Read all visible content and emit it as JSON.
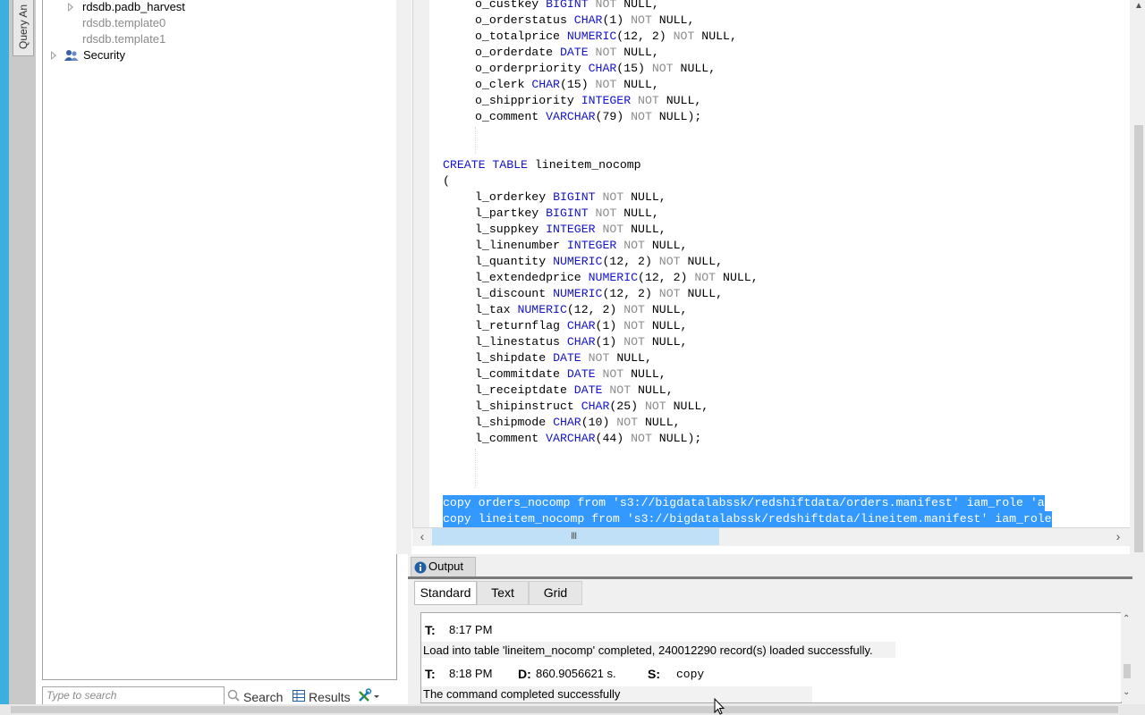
{
  "left_strip": {
    "vertical_tab_label": "Query An"
  },
  "tree": {
    "nodes": [
      {
        "label": "rdsdb.padb_harvest",
        "expandable": true,
        "muted": false
      },
      {
        "label": "rdsdb.template0",
        "expandable": false,
        "muted": true
      },
      {
        "label": "rdsdb.template1",
        "expandable": false,
        "muted": true
      },
      {
        "label": "Security",
        "expandable": true,
        "muted": false,
        "icon": "users-icon"
      }
    ]
  },
  "bottom_left": {
    "search_placeholder": "Type to search",
    "search_button": "Search",
    "results_button": "Results",
    "tools_icon": "tools-icon"
  },
  "editor": {
    "orders_cols": [
      {
        "name": "o_custkey",
        "type": "BIGINT",
        "args": "",
        "suffix": ","
      },
      {
        "name": "o_orderstatus",
        "type": "CHAR",
        "args": "(1)",
        "suffix": ","
      },
      {
        "name": "o_totalprice",
        "type": "NUMERIC",
        "args": "(12, 2)",
        "suffix": ","
      },
      {
        "name": "o_orderdate",
        "type": "DATE",
        "args": "",
        "suffix": ","
      },
      {
        "name": "o_orderpriority",
        "type": "CHAR",
        "args": "(15)",
        "suffix": ","
      },
      {
        "name": "o_clerk",
        "type": "CHAR",
        "args": "(15)",
        "suffix": ","
      },
      {
        "name": "o_shippriority",
        "type": "INTEGER",
        "args": "",
        "suffix": ","
      },
      {
        "name": "o_comment",
        "type": "VARCHAR",
        "args": "(79)",
        "suffix": ");"
      }
    ],
    "create_kw": "CREATE TABLE",
    "table_name": "lineitem_nocomp",
    "open_paren": "(",
    "lineitem_cols": [
      {
        "name": "l_orderkey",
        "type": "BIGINT",
        "args": "",
        "suffix": ","
      },
      {
        "name": "l_partkey",
        "type": "BIGINT",
        "args": "",
        "suffix": ","
      },
      {
        "name": "l_suppkey",
        "type": "INTEGER",
        "args": "",
        "suffix": ","
      },
      {
        "name": "l_linenumber",
        "type": "INTEGER",
        "args": "",
        "suffix": ","
      },
      {
        "name": "l_quantity",
        "type": "NUMERIC",
        "args": "(12, 2)",
        "suffix": ","
      },
      {
        "name": "l_extendedprice",
        "type": "NUMERIC",
        "args": "(12, 2)",
        "suffix": ","
      },
      {
        "name": "l_discount",
        "type": "NUMERIC",
        "args": "(12, 2)",
        "suffix": ","
      },
      {
        "name": "l_tax",
        "type": "NUMERIC",
        "args": "(12, 2)",
        "suffix": ","
      },
      {
        "name": "l_returnflag",
        "type": "CHAR",
        "args": "(1)",
        "suffix": ","
      },
      {
        "name": "l_linestatus",
        "type": "CHAR",
        "args": "(1)",
        "suffix": ","
      },
      {
        "name": "l_shipdate",
        "type": "DATE",
        "args": "",
        "suffix": ","
      },
      {
        "name": "l_commitdate",
        "type": "DATE",
        "args": "",
        "suffix": ","
      },
      {
        "name": "l_receiptdate",
        "type": "DATE",
        "args": "",
        "suffix": ","
      },
      {
        "name": "l_shipinstruct",
        "type": "CHAR",
        "args": "(25)",
        "suffix": ","
      },
      {
        "name": "l_shipmode",
        "type": "CHAR",
        "args": "(10)",
        "suffix": ","
      },
      {
        "name": "l_comment",
        "type": "VARCHAR",
        "args": "(44)",
        "suffix": ");"
      }
    ],
    "not_kw": "NOT",
    "null_kw": "NULL",
    "copy_lines": [
      "copy orders_nocomp from 's3://bigdatalabssk/redshiftdata/orders.manifest' iam_role 'a",
      "copy lineitem_nocomp from 's3://bigdatalabssk/redshiftdata/lineitem.manifest' iam_role"
    ],
    "hscroll_grip": "III"
  },
  "output": {
    "tab_label": "Output",
    "subtabs": [
      "Standard",
      "Text",
      "Grid"
    ],
    "active_subtab": "Standard",
    "entries": {
      "t_label": "T:",
      "d_label": "D:",
      "s_label": "S:",
      "time1": "8:17 PM",
      "msg1": "Load into table 'lineitem_nocomp' completed, 240012290 record(s) loaded successfully.",
      "time2": "8:18 PM",
      "duration2": "860.9056621 s.",
      "stmt2": "copy",
      "msg2": "The command completed successfully"
    }
  }
}
